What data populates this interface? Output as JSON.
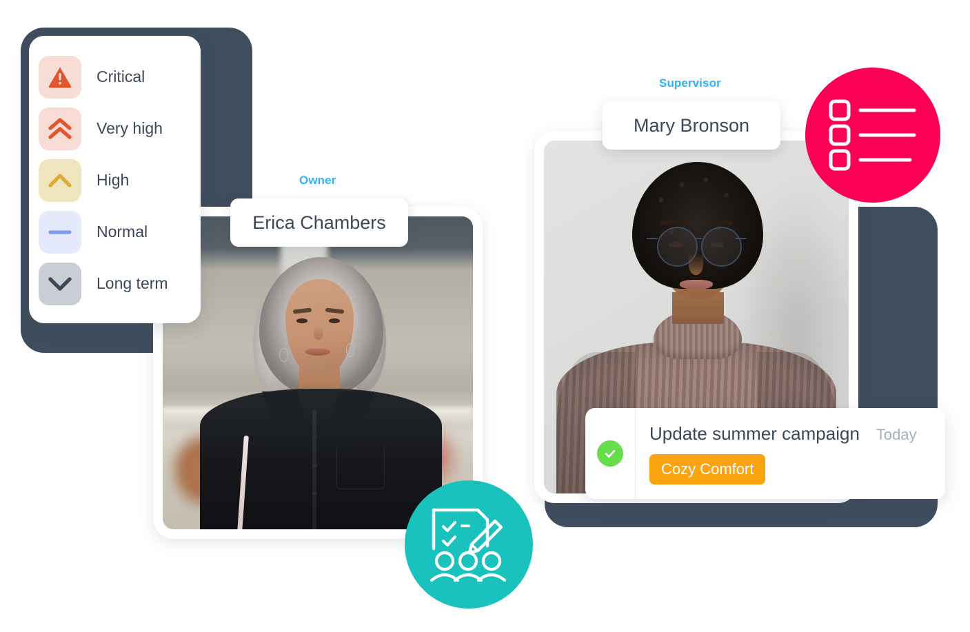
{
  "priority_legend": {
    "items": [
      {
        "label": "Critical",
        "icon": "critical-triangle-icon",
        "swatch_bg": "#f8ddd6",
        "icon_color": "#e0562f"
      },
      {
        "label": "Very high",
        "icon": "double-chevron-up-icon",
        "swatch_bg": "#f8dcd5",
        "icon_color": "#e0562f"
      },
      {
        "label": "High",
        "icon": "chevron-up-icon",
        "swatch_bg": "#f0e4bd",
        "icon_color": "#ddab33"
      },
      {
        "label": "Normal",
        "icon": "minus-dash-icon",
        "swatch_bg": "#e4e9fb",
        "icon_color": "#7e9cf0"
      },
      {
        "label": "Long term",
        "icon": "chevron-down-icon",
        "swatch_bg": "#c9ced6",
        "icon_color": "#3c4858"
      }
    ]
  },
  "people": [
    {
      "role": "Owner",
      "name": "Erica Chambers",
      "role_color": "#30b0f7"
    },
    {
      "role": "Supervisor",
      "name": "Mary Bronson",
      "role_color": "#30b0f7"
    }
  ],
  "task": {
    "completed": true,
    "check_icon": "check-circle-icon",
    "check_color": "#66dd4d",
    "title": "Update summer campaign",
    "due": "Today",
    "tag": "Cozy Comfort",
    "tag_color": "#fca311"
  },
  "badges": [
    {
      "icon": "checklist-icon",
      "color": "#fc0055"
    },
    {
      "icon": "team-review-icon",
      "color": "#19c2bd"
    }
  ],
  "theme": {
    "navy_card": "#3f4e5e",
    "text": "#3c4858",
    "muted_text": "#a6b0bd"
  }
}
